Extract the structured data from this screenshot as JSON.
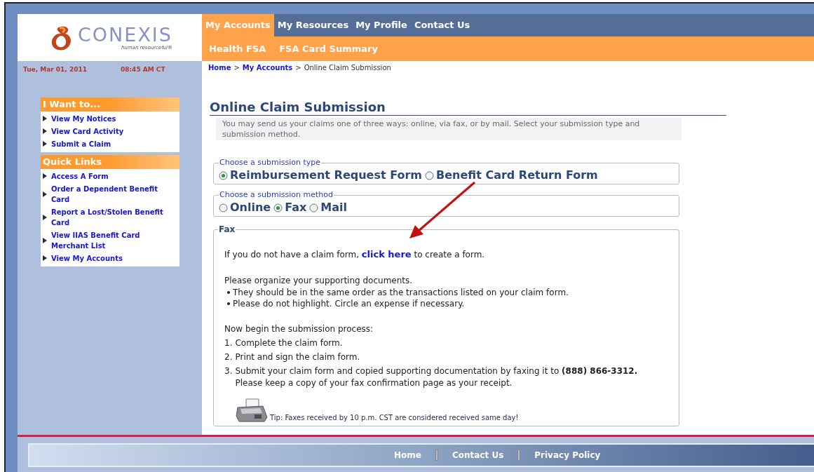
{
  "logo": {
    "name": "CONEXIS",
    "tagline": "human resourceful®"
  },
  "date": "Tue, Mar 01, 2011",
  "time": "08:45 AM CT",
  "sidebar_panels": [
    {
      "title": "I Want to...",
      "links": [
        "View My Notices",
        "View Card Activity",
        "Submit a Claim"
      ]
    },
    {
      "title": "Quick Links",
      "links": [
        "Access A Form",
        "Order a Dependent Benefit Card",
        "Report a Lost/Stolen Benefit Card",
        "View IIAS Benefit Card Merchant List",
        "View My Accounts"
      ]
    }
  ],
  "nav_tabs": [
    {
      "label": "My Accounts",
      "selected": true
    },
    {
      "label": "My Resources",
      "selected": false
    },
    {
      "label": "My Profile",
      "selected": false
    },
    {
      "label": "Contact Us",
      "selected": false
    }
  ],
  "sub_nav": [
    "Health FSA",
    "FSA Card Summary"
  ],
  "breadcrumb": {
    "links": [
      "Home",
      "My Accounts"
    ],
    "separator": ">",
    "current": "Online Claim Submission"
  },
  "page_title": "Online Claim Submission",
  "intro": "You may send us your claims one of three ways: online, via fax, or by mail. Select your submission type and submission method.",
  "option_groups": [
    {
      "legend": "Choose a submission type",
      "options": [
        {
          "label": "Reimbursement Request Form",
          "selected": true
        },
        {
          "label": "Benefit Card Return Form",
          "selected": false
        }
      ]
    },
    {
      "legend": "Choose a submission method",
      "options": [
        {
          "label": "Online",
          "selected": false
        },
        {
          "label": "Fax",
          "selected": true
        },
        {
          "label": "Mail",
          "selected": false
        }
      ]
    }
  ],
  "fax_panel": {
    "legend": "Fax",
    "claim_form_before": "If you do not have a claim form, ",
    "claim_form_link": "click here",
    "claim_form_after": " to create a form.",
    "organize_intro": "Please organize your supporting documents.",
    "organize_bullets": [
      "They should be in the same order as the transactions listed on your claim form.",
      "Please do not highlight. Circle an expense if necessary."
    ],
    "process_intro": "Now begin the submission process:",
    "steps": [
      {
        "number": "1.",
        "text": "Complete the claim form."
      },
      {
        "number": "2.",
        "text": "Print and sign the claim form."
      },
      {
        "number": "3.",
        "text": "Submit your claim form and copied supporting documentation by faxing it to **(888) 866-3312.**",
        "note": "Please keep a copy of your fax confirmation page as your receipt."
      }
    ],
    "tip": "Tip: Faxes received by 10 p.m. CST are considered received same day!"
  },
  "footer_links": [
    "Home",
    "Contact Us",
    "Privacy Policy"
  ]
}
